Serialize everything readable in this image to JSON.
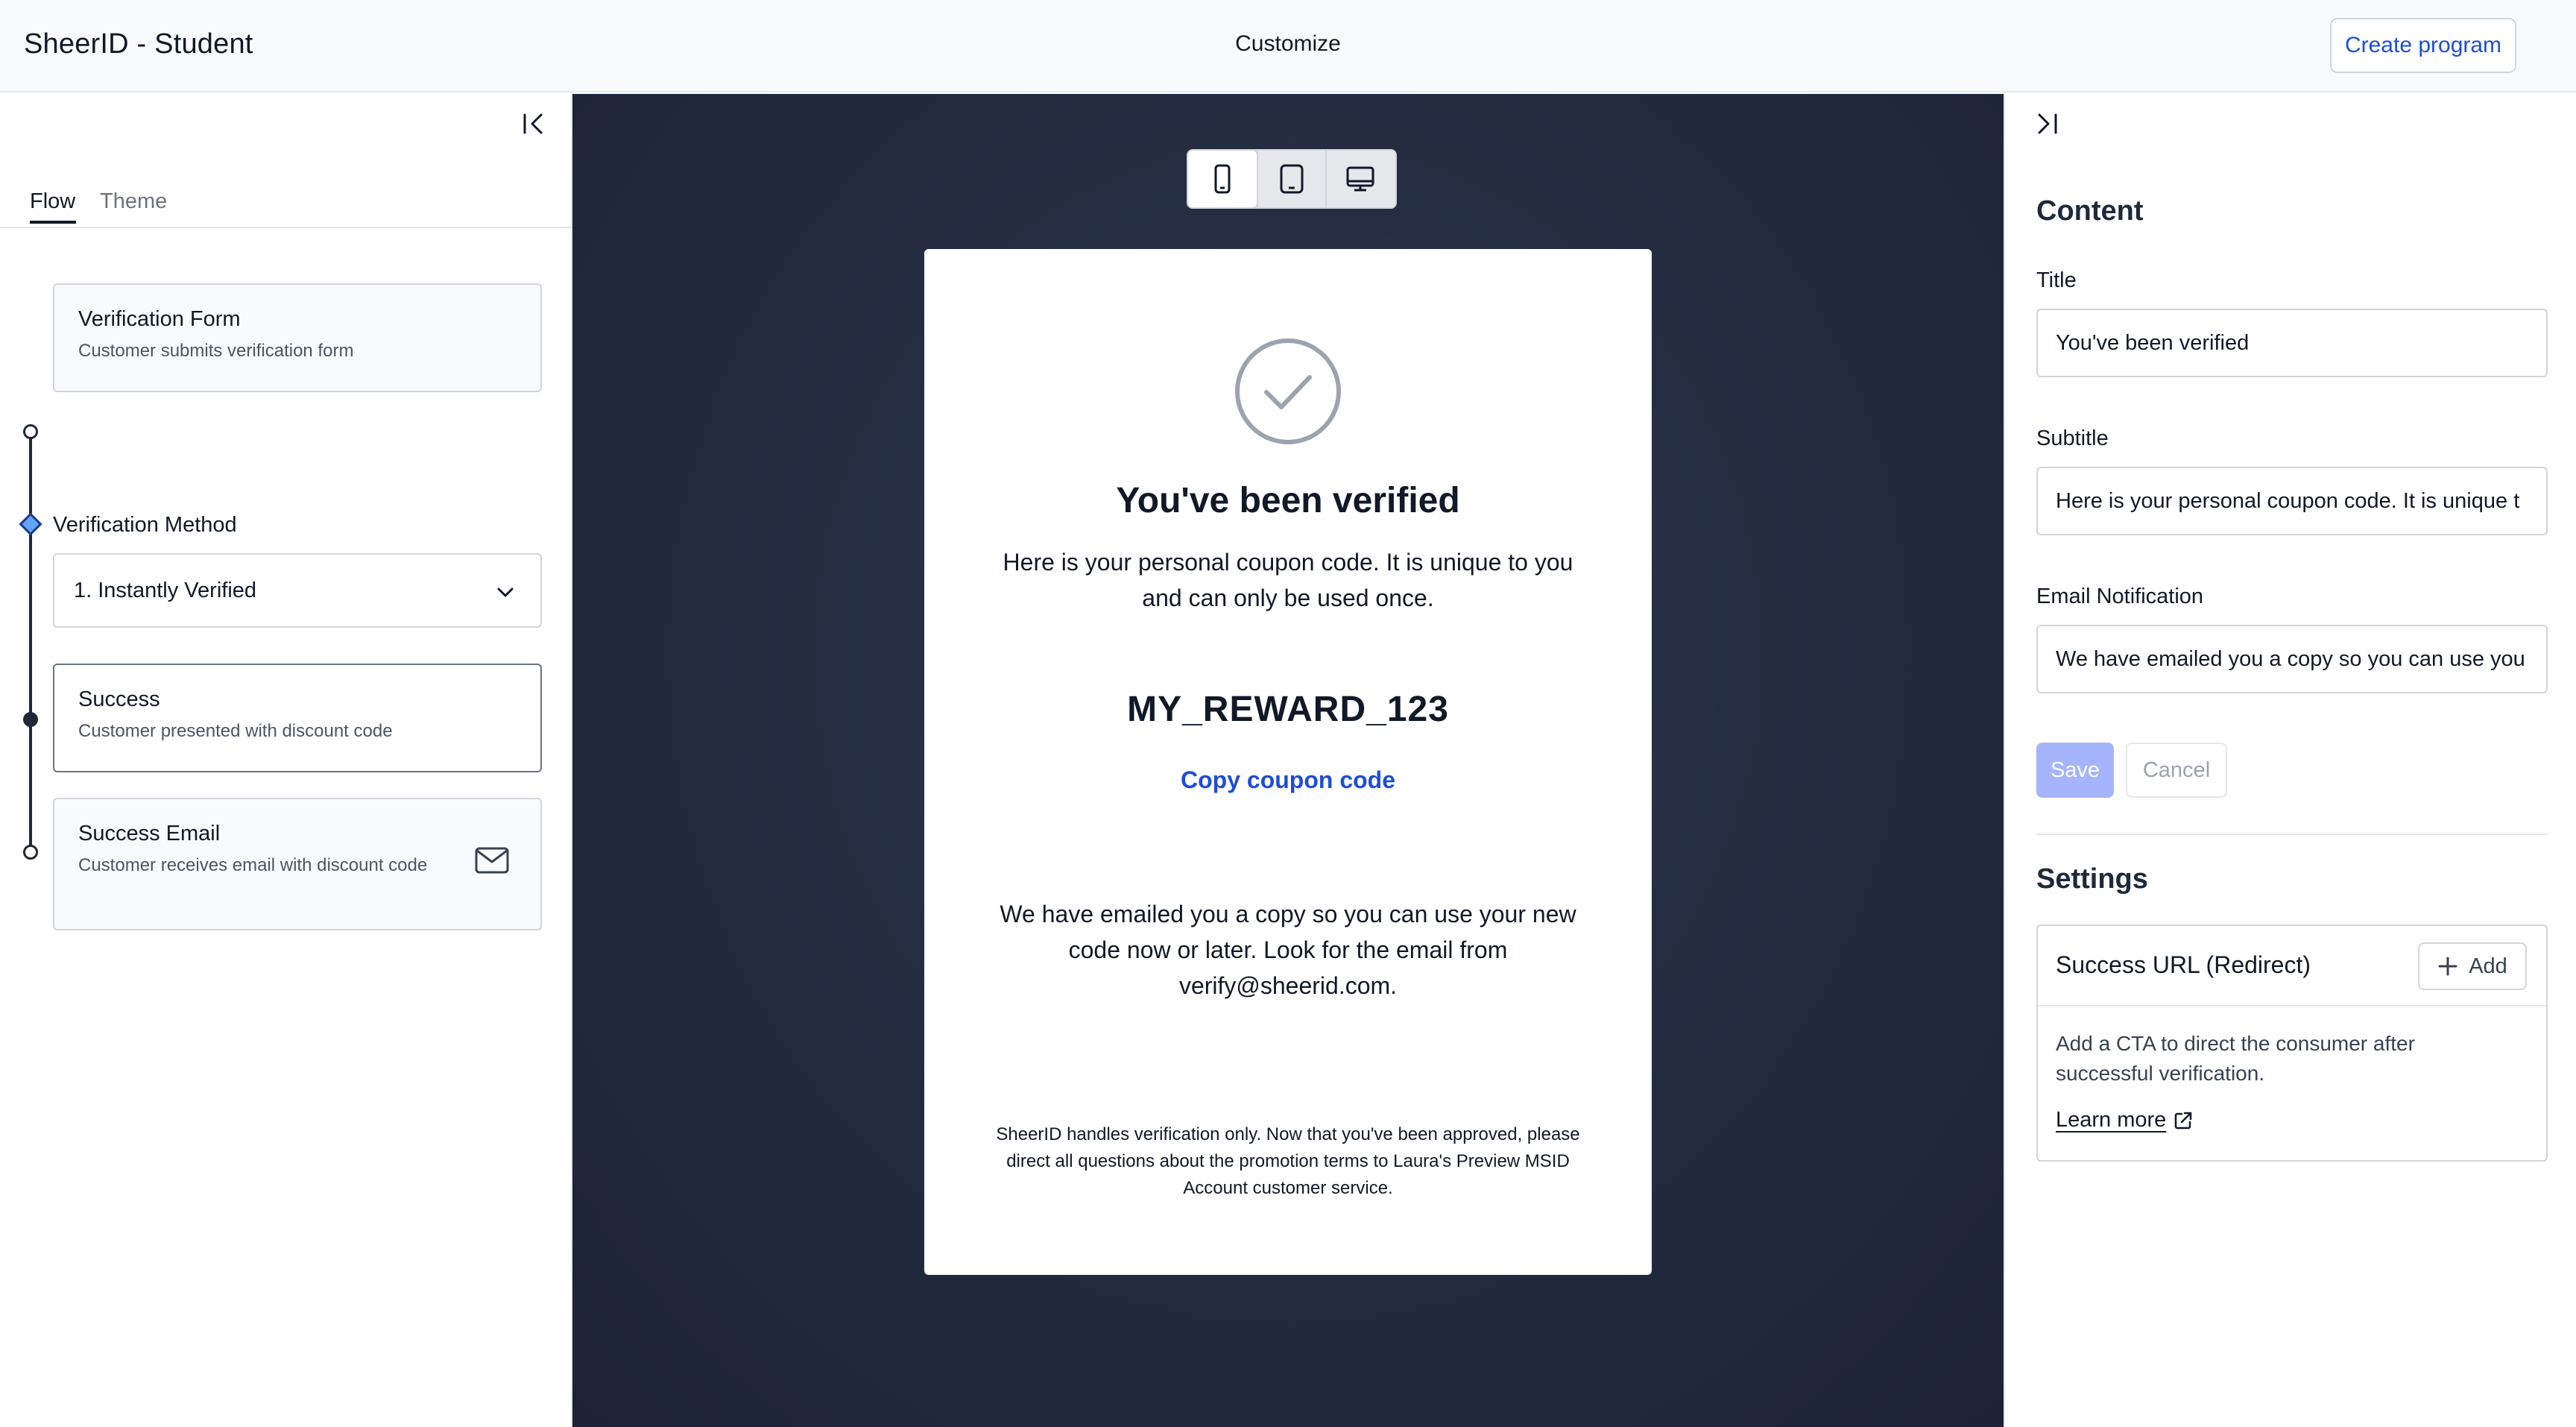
{
  "header": {
    "app_title": "SheerID - Student",
    "center_title": "Customize",
    "create_button": "Create program"
  },
  "left_panel": {
    "tabs": [
      {
        "label": "Flow",
        "active": true
      },
      {
        "label": "Theme",
        "active": false
      }
    ],
    "steps": {
      "verification_form": {
        "title": "Verification Form",
        "subtitle": "Customer submits verification form"
      },
      "verification_method": {
        "label": "Verification Method",
        "selected": "1. Instantly Verified"
      },
      "success": {
        "title": "Success",
        "subtitle": "Customer presented with discount code"
      },
      "success_email": {
        "title": "Success Email",
        "subtitle": "Customer receives email with discount code"
      }
    },
    "icons": {
      "collapse": "collapse-left-icon",
      "chevron": "chevron-down-icon",
      "mail": "mail-icon"
    }
  },
  "preview": {
    "device_options": [
      "mobile",
      "tablet",
      "desktop"
    ],
    "selected_device": "mobile",
    "card": {
      "title": "You've been verified",
      "subtitle": "Here is your personal coupon code. It is unique to you and can only be used once.",
      "coupon_code": "MY_REWARD_123",
      "copy_link": "Copy coupon code",
      "email_note": "We have emailed you a copy so you can use your new code now or later. Look for the email from verify@sheerid.com.",
      "disclaimer": "SheerID handles verification only. Now that you've been approved, please direct all questions about the promotion terms to Laura's Preview MSID Account customer service."
    }
  },
  "right_panel": {
    "content_title": "Content",
    "fields": {
      "title": {
        "label": "Title",
        "value": "You've been verified"
      },
      "subtitle": {
        "label": "Subtitle",
        "value": "Here is your personal coupon code. It is unique t"
      },
      "email_notification": {
        "label": "Email Notification",
        "value": "We have emailed you a copy so you can use you"
      }
    },
    "save_label": "Save",
    "cancel_label": "Cancel",
    "settings_title": "Settings",
    "success_url": {
      "title": "Success URL (Redirect)",
      "add_label": "Add",
      "description": "Add a CTA to direct the consumer after successful verification.",
      "learn_more": "Learn more"
    }
  },
  "colors": {
    "accent": "#1d4ed8",
    "save_disabled": "#a5b4fc",
    "preview_bg": "#242d41",
    "diamond": "#60a5fa"
  }
}
